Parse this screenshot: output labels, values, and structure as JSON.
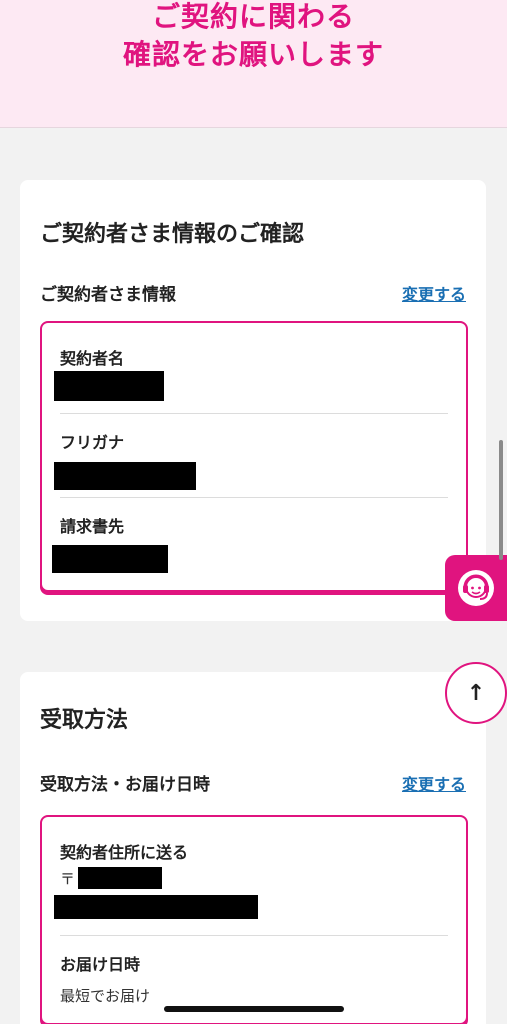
{
  "hero": {
    "line1": "ご契約に関わる",
    "line2": "確認をお願いします"
  },
  "contract_card": {
    "title": "ご契約者さま情報のご確認",
    "section_label": "ご契約者さま情報",
    "change_label": "変更する",
    "fields": [
      {
        "label": "契約者名"
      },
      {
        "label": "フリガナ"
      },
      {
        "label": "請求書先"
      }
    ]
  },
  "receive_card": {
    "title": "受取方法",
    "section_label": "受取方法・お届け日時",
    "change_label": "変更する",
    "address_label": "契約者住所に送る",
    "postal_prefix": "〒",
    "delivery_label": "お届け日時",
    "delivery_value": "最短でお届け"
  },
  "fab": {
    "top_arrow": "↑"
  },
  "colors": {
    "accent": "#e0147f",
    "hero_bg": "#fde9f3",
    "link": "#1a6fb3"
  }
}
